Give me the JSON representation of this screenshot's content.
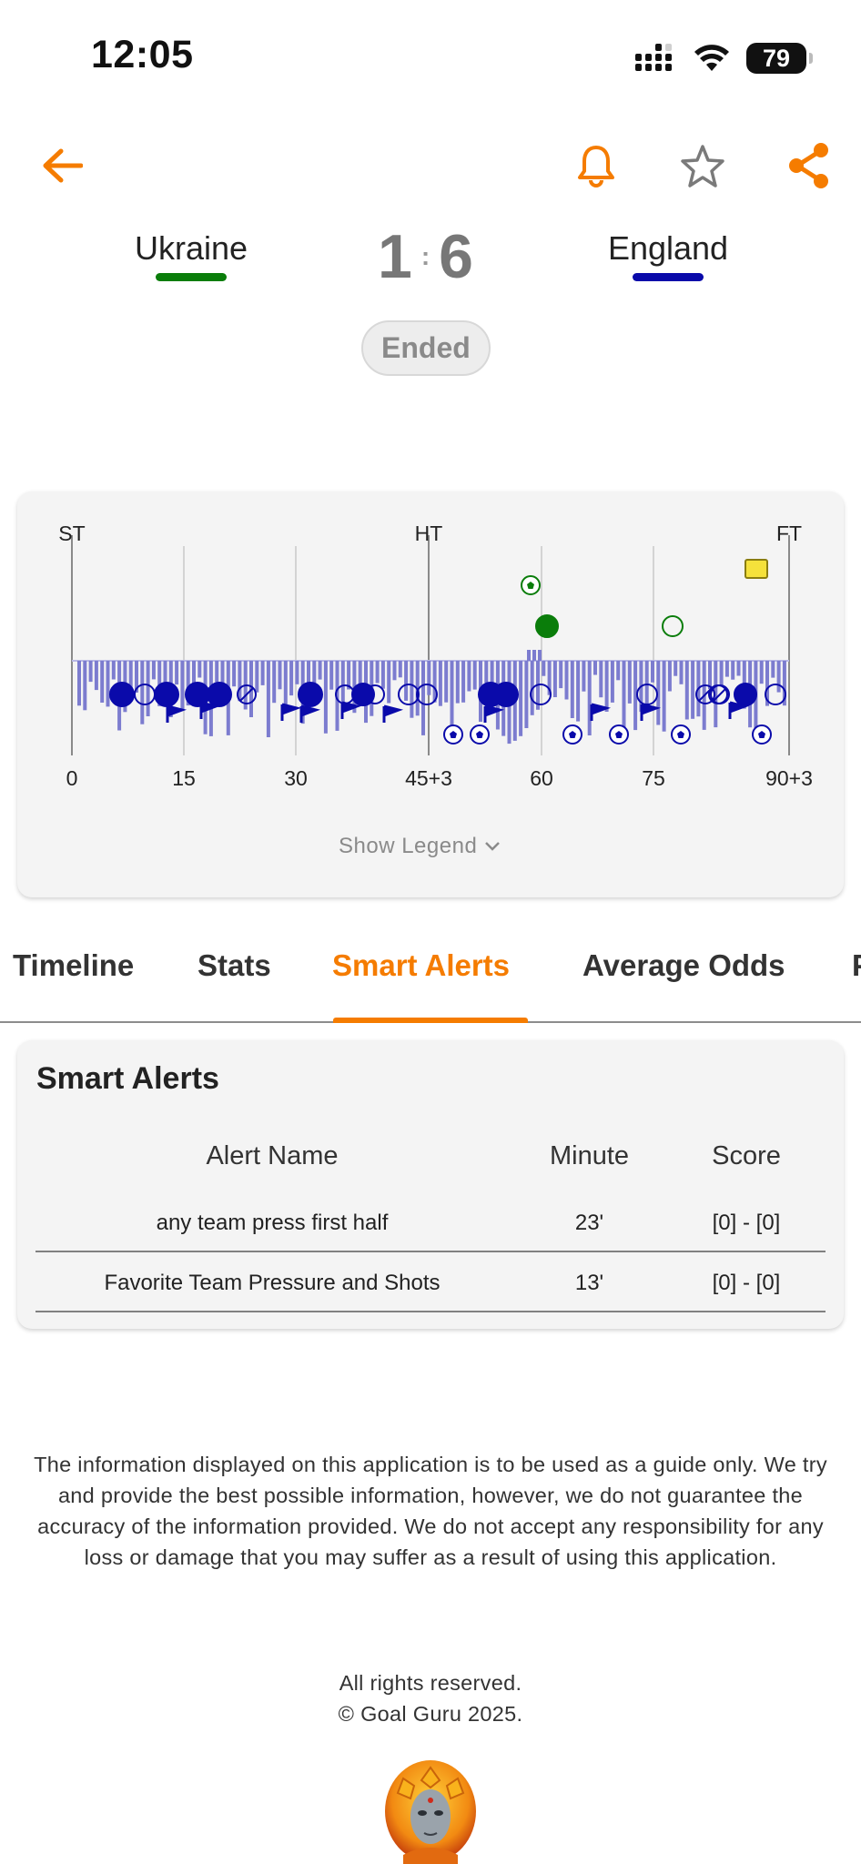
{
  "status_bar": {
    "time": "12:05",
    "battery": "79"
  },
  "header": {
    "back_icon": "arrow-left-icon",
    "bell_icon": "bell-icon",
    "star_icon": "star-outline-icon",
    "share_icon": "share-icon",
    "accent": "#f57c00"
  },
  "match": {
    "home_team": "Ukraine",
    "home_color": "#0a7d0a",
    "away_team": "England",
    "away_color": "#0a0aaa",
    "home_score": "1",
    "separator": ":",
    "away_score": "6",
    "status": "Ended"
  },
  "timeline_chart": {
    "phase_labels": [
      "ST",
      "HT",
      "FT"
    ],
    "minute_ticks": [
      "0",
      "15",
      "30",
      "45+3",
      "60",
      "75",
      "90+3"
    ],
    "show_legend_label": "Show Legend"
  },
  "tabs": [
    "Timeline",
    "Stats",
    "Smart Alerts",
    "Average Odds",
    "P"
  ],
  "active_tab": "Smart Alerts",
  "smart_alerts": {
    "title": "Smart Alerts",
    "columns": [
      "Alert Name",
      "Minute",
      "Score"
    ],
    "rows": [
      {
        "name": "any team press first half",
        "minute": "23'",
        "score": "[0] - [0]"
      },
      {
        "name": "Favorite Team Pressure and Shots",
        "minute": "13'",
        "score": "[0] - [0]"
      }
    ]
  },
  "footer": {
    "disclaimer": "The information displayed on this application is to be used as a guide only. We try and provide the best possible information, however, we do not guarantee the accuracy of the information provided. We do not accept any responsibility for any loss or damage that you may suffer as a result of using this application.",
    "rights": "All rights reserved.",
    "copyright": "© Goal Guru 2025.",
    "logo_icon": "goal-guru-logo"
  }
}
